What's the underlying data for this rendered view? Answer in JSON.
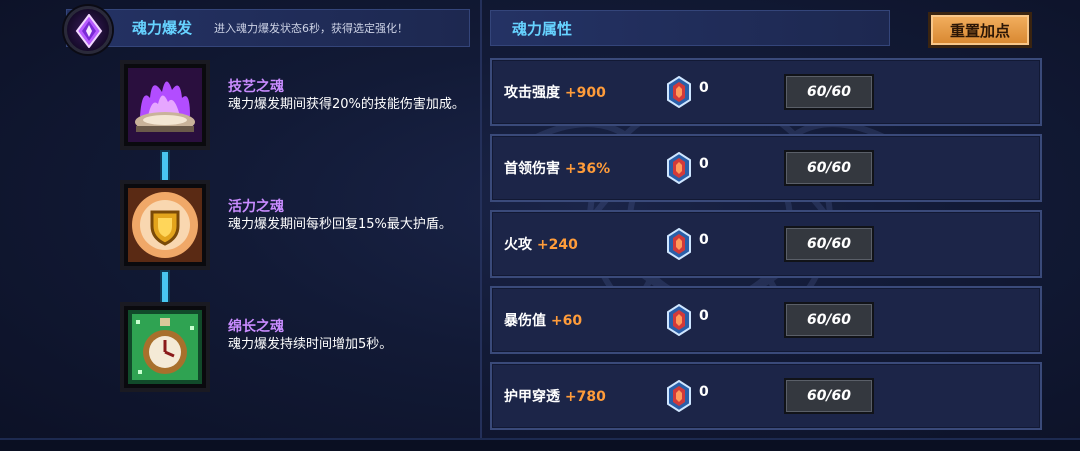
{
  "burst": {
    "title": "魂力爆发",
    "description": "进入魂力爆发状态6秒，获得选定强化！"
  },
  "souls": [
    {
      "name": "技艺之魂",
      "description": "魂力爆发期间获得20%的技能伤害加成。",
      "icon": "purple-flame-icon"
    },
    {
      "name": "活力之魂",
      "description": "魂力爆发期间每秒回复15%最大护盾。",
      "icon": "gold-shield-icon"
    },
    {
      "name": "绵长之魂",
      "description": "魂力爆发持续时间增加5秒。",
      "icon": "stopwatch-icon"
    }
  ],
  "attributes": {
    "title": "魂力属性",
    "reset_label": "重置加点",
    "rows": [
      {
        "label": "攻击强度",
        "bonus": "+900",
        "gems": "0",
        "level": "60/60"
      },
      {
        "label": "首领伤害",
        "bonus": "+36%",
        "gems": "0",
        "level": "60/60"
      },
      {
        "label": "火攻",
        "bonus": "+240",
        "gems": "0",
        "level": "60/60"
      },
      {
        "label": "暴伤值",
        "bonus": "+60",
        "gems": "0",
        "level": "60/60"
      },
      {
        "label": "护甲穿透",
        "bonus": "+780",
        "gems": "0",
        "level": "60/60"
      }
    ]
  },
  "colors": {
    "header_text": "#66d2ff",
    "soul_name": "#c98cff",
    "bonus": "#ff9c3a",
    "reset_button": "#e79a45"
  }
}
